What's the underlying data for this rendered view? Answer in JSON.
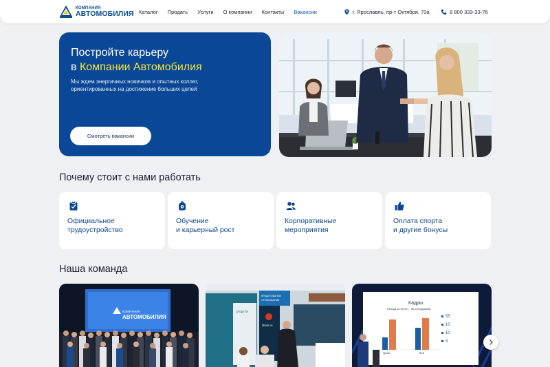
{
  "header": {
    "logo_top": "КОМПАНИЯ",
    "logo_main": "АВТОМОБИЛИЯ",
    "nav": [
      "Каталог",
      "Продать",
      "Услуги",
      "О компании",
      "Контакты",
      "Вакансии"
    ],
    "active_nav": "Вакансии",
    "address": "г. Ярославль, пр-т Октября, 73а",
    "phone": "8 800 333-33-76",
    "icons": {
      "address": "location-pin-icon",
      "phone": "phone-icon"
    }
  },
  "hero": {
    "title_line1": "Постройте карьеру",
    "title_prefix": "в ",
    "title_accent": "Компании Автомобилия",
    "subtitle": "Мы ждем энергичных новичков и опытных коллег, ориентированных на достижение больших целей",
    "button": "Смотреть вакансии",
    "colors": {
      "background": "#0b4797",
      "accent": "#f2e33a"
    }
  },
  "why": {
    "title": "Почему стоит с нами работать",
    "items": [
      {
        "label": "Официальное\nтрудоустройство",
        "icon": "clipboard-check-icon"
      },
      {
        "label": "Обучение\nи карьерный рост",
        "icon": "badge-icon"
      },
      {
        "label": "Корпоративные\nмероприятия",
        "icon": "people-icon"
      },
      {
        "label": "Оплата спорта\nи другие бонусы",
        "icon": "thumbs-up-icon"
      }
    ]
  },
  "team": {
    "title": "Наша команда",
    "photo1_screen_logo_top": "КОМПАНИЯ",
    "photo1_screen_logo_main": "АВТОМОБИЛИЯ",
    "photo2_sign1": "КРЕДИТОВАНИЕ\nСТРАХОВАНИЕ",
    "photo2_sign2": "ЗАЩИТИ",
    "photo2_sign3": "drom.ru",
    "photo3_slide_title": "Кадры",
    "photo3_slide_subtitle": "Рекорд за 25 лет - 90 сотрудников",
    "photo3_slide_numbers": [
      "55",
      "10",
      "10",
      "9"
    ],
    "photo3_bars": [
      {
        "label": "Прием",
        "values": [
          15,
          40
        ]
      },
      {
        "label": "ВСЕ",
        "values": [
          30,
          42
        ]
      }
    ],
    "next_icon": "chevron-right-icon"
  }
}
